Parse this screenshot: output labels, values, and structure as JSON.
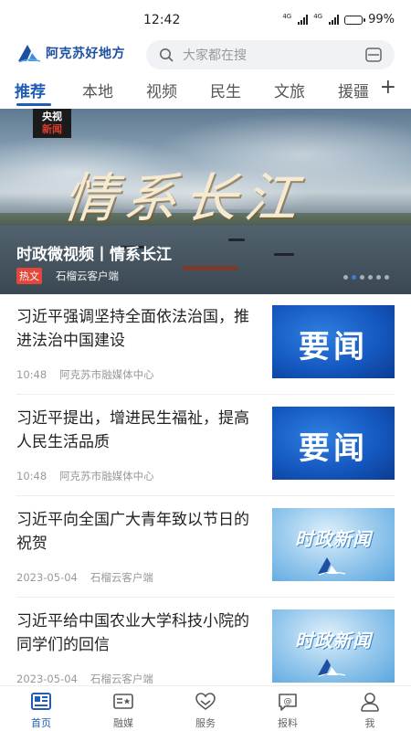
{
  "status_bar": {
    "time": "12:42",
    "network_1": "4G",
    "network_2": "4G",
    "battery_percent": "99%",
    "battery_level": 0.99
  },
  "header": {
    "app_name": "阿克苏好地方",
    "search_placeholder": "大家都在搜"
  },
  "tabs": [
    {
      "label": "推荐",
      "active": true
    },
    {
      "label": "本地",
      "active": false
    },
    {
      "label": "视频",
      "active": false
    },
    {
      "label": "民生",
      "active": false
    },
    {
      "label": "文旅",
      "active": false
    },
    {
      "label": "援疆",
      "active": false
    }
  ],
  "tabs_add": "+",
  "banner": {
    "channel_logo_top": "央视",
    "channel_logo_bottom": "新闻",
    "calligraphy": "情系长江",
    "title": "时政微视频丨情系长江",
    "tag": "热文",
    "source": "石榴云客户端",
    "slide_count": 6,
    "active_slide": 2
  },
  "feed": [
    {
      "title": "习近平强调坚持全面依法治国，推进法治中国建设",
      "time": "10:48",
      "source": "阿克苏市融媒体中心",
      "thumb": "yaowen",
      "thumb_text": "要闻"
    },
    {
      "title": "习近平提出，增进民生福祉，提高人民生活品质",
      "time": "10:48",
      "source": "阿克苏市融媒体中心",
      "thumb": "yaowen",
      "thumb_text": "要闻"
    },
    {
      "title": "习近平向全国广大青年致以节日的祝贺",
      "time": "2023-05-04",
      "source": "石榴云客户端",
      "thumb": "shizheng",
      "thumb_text": "时政新闻"
    },
    {
      "title": "习近平给中国农业大学科技小院的同学们的回信",
      "time": "2023-05-04",
      "source": "石榴云客户端",
      "thumb": "shizheng",
      "thumb_text": "时政新闻"
    }
  ],
  "bottom_nav": [
    {
      "label": "首页",
      "icon": "home-icon",
      "active": true
    },
    {
      "label": "融媒",
      "icon": "media-icon",
      "active": false
    },
    {
      "label": "服务",
      "icon": "service-icon",
      "active": false
    },
    {
      "label": "报料",
      "icon": "report-icon",
      "active": false
    },
    {
      "label": "我",
      "icon": "profile-icon",
      "active": false
    }
  ],
  "colors": {
    "accent": "#1f5db6",
    "hot_tag": "#e4473a"
  }
}
